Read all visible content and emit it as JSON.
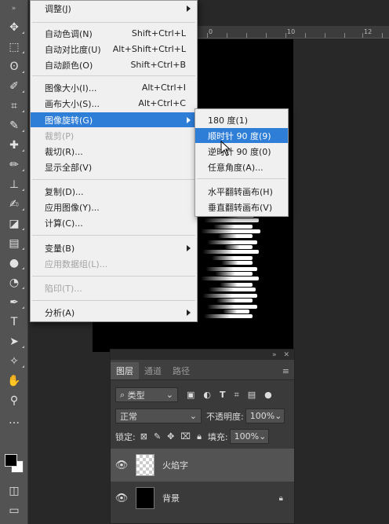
{
  "toolbar": {
    "tools": [
      "move-icon",
      "marquee-icon",
      "lasso-icon",
      "quick-select-icon",
      "crop-icon",
      "eyedropper-icon",
      "healing-icon",
      "brush-icon",
      "stamp-icon",
      "history-brush-icon",
      "eraser-icon",
      "gradient-icon",
      "blur-icon",
      "dodge-icon",
      "pen-icon",
      "type-icon",
      "path-select-icon",
      "shape-icon",
      "hand-icon",
      "zoom-icon",
      "more-icon"
    ]
  },
  "ruler": {
    "labels": [
      "0",
      "10",
      "12"
    ]
  },
  "image_menu": {
    "items": [
      {
        "label": "调整(J)",
        "shortcut": "",
        "submenu": true,
        "disabled": false
      },
      {
        "label": "自动色调(N)",
        "shortcut": "Shift+Ctrl+L",
        "submenu": false,
        "disabled": false
      },
      {
        "label": "自动对比度(U)",
        "shortcut": "Alt+Shift+Ctrl+L",
        "submenu": false,
        "disabled": false
      },
      {
        "label": "自动颜色(O)",
        "shortcut": "Shift+Ctrl+B",
        "submenu": false,
        "disabled": false
      },
      {
        "label": "图像大小(I)...",
        "shortcut": "Alt+Ctrl+I",
        "submenu": false,
        "disabled": false
      },
      {
        "label": "画布大小(S)...",
        "shortcut": "Alt+Ctrl+C",
        "submenu": false,
        "disabled": false
      },
      {
        "label": "图像旋转(G)",
        "shortcut": "",
        "submenu": true,
        "disabled": false,
        "highlighted": true
      },
      {
        "label": "裁剪(P)",
        "shortcut": "",
        "submenu": false,
        "disabled": true
      },
      {
        "label": "裁切(R)...",
        "shortcut": "",
        "submenu": false,
        "disabled": false
      },
      {
        "label": "显示全部(V)",
        "shortcut": "",
        "submenu": false,
        "disabled": false
      },
      {
        "label": "复制(D)...",
        "shortcut": "",
        "submenu": false,
        "disabled": false
      },
      {
        "label": "应用图像(Y)...",
        "shortcut": "",
        "submenu": false,
        "disabled": false
      },
      {
        "label": "计算(C)...",
        "shortcut": "",
        "submenu": false,
        "disabled": false
      },
      {
        "label": "变量(B)",
        "shortcut": "",
        "submenu": true,
        "disabled": false
      },
      {
        "label": "应用数据组(L)...",
        "shortcut": "",
        "submenu": false,
        "disabled": true
      },
      {
        "label": "陷印(T)...",
        "shortcut": "",
        "submenu": false,
        "disabled": true
      },
      {
        "label": "分析(A)",
        "shortcut": "",
        "submenu": true,
        "disabled": false
      }
    ]
  },
  "rotation_submenu": {
    "items": [
      {
        "label": "180 度(1)",
        "highlighted": false
      },
      {
        "label": "顺时针 90 度(9)",
        "highlighted": true
      },
      {
        "label": "逆时针 90 度(0)",
        "highlighted": false
      },
      {
        "label": "任意角度(A)...",
        "highlighted": false
      },
      {
        "label": "水平翻转画布(H)",
        "highlighted": false
      },
      {
        "label": "垂直翻转画布(V)",
        "highlighted": false
      }
    ]
  },
  "layers_panel": {
    "tabs": [
      "图层",
      "通道",
      "路径"
    ],
    "active_tab": "图层",
    "filter_kind": "类型",
    "blend_mode": "正常",
    "opacity_label": "不透明度:",
    "opacity_value": "100%",
    "lock_label": "锁定:",
    "fill_label": "填充:",
    "fill_value": "100%",
    "layers": [
      {
        "name": "火焰字",
        "selected": true,
        "thumbnail": "transparent",
        "locked": false
      },
      {
        "name": "背景",
        "selected": false,
        "thumbnail": "black",
        "locked": true
      }
    ]
  }
}
